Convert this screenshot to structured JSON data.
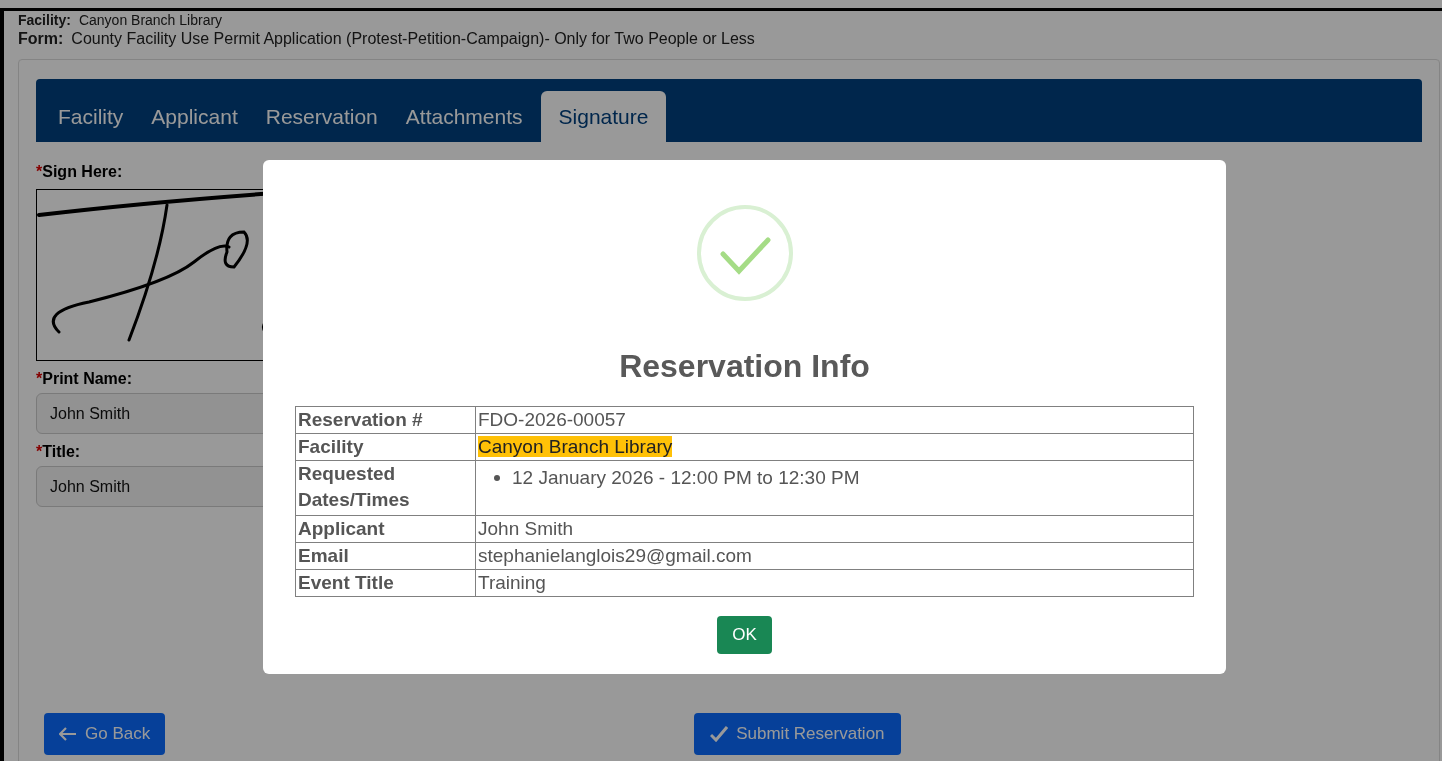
{
  "header": {
    "facility_label": "Facility:",
    "facility_value": "Canyon Branch Library",
    "form_label": "Form:",
    "form_value": "County Facility Use Permit Application (Protest-Petition-Campaign)- Only for Two People or Less"
  },
  "tabs": [
    {
      "label": "Facility",
      "selected": false
    },
    {
      "label": "Applicant",
      "selected": false
    },
    {
      "label": "Reservation",
      "selected": false
    },
    {
      "label": "Attachments",
      "selected": false
    },
    {
      "label": "Signature",
      "selected": true
    }
  ],
  "signature": {
    "required_mark": "*",
    "label": "Sign Here:"
  },
  "fields": [
    {
      "required_mark": "*",
      "label": "Print Name:",
      "value": "John Smith"
    },
    {
      "required_mark": "*",
      "label": "Title:",
      "value": "John Smith"
    }
  ],
  "buttons": {
    "back": "Go Back",
    "submit": "Submit Reservation"
  },
  "modal": {
    "title": "Reservation Info",
    "rows": [
      {
        "label": "Reservation #",
        "value": "FDO-2026-00057",
        "kind": "text"
      },
      {
        "label": "Facility",
        "value": "Canyon Branch Library",
        "kind": "highlight"
      },
      {
        "label": "Requested Dates/Times",
        "items": [
          "12 January 2026 - 12:00 PM to 12:30 PM"
        ],
        "kind": "list"
      },
      {
        "label": "Applicant",
        "value": "John Smith",
        "kind": "text"
      },
      {
        "label": "Email",
        "value": "stephanielanglois29@gmail.com",
        "kind": "text"
      },
      {
        "label": "Event Title",
        "value": "Training",
        "kind": "text"
      }
    ],
    "ok": "OK"
  }
}
